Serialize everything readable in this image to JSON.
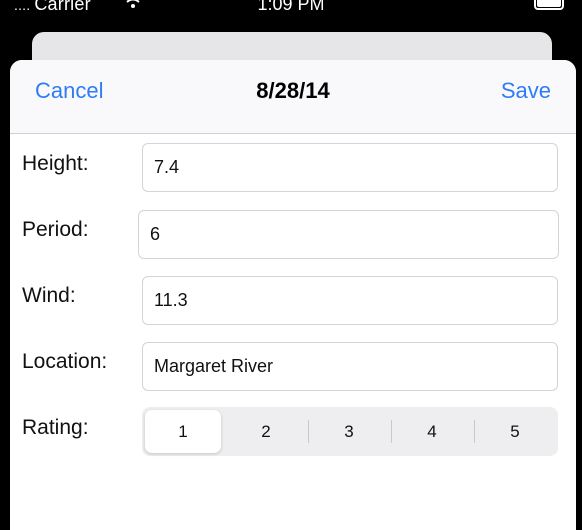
{
  "status_bar": {
    "carrier": "Carrier",
    "carrier_signal": "....",
    "time": "1:09 PM",
    "icons": [
      "wifi-icon",
      "battery-icon"
    ]
  },
  "nav": {
    "cancel_label": "Cancel",
    "title": "8/28/14",
    "save_label": "Save"
  },
  "form": {
    "height": {
      "label": "Height:",
      "value": "7.4"
    },
    "period": {
      "label": "Period:",
      "value": "6"
    },
    "wind": {
      "label": "Wind:",
      "value": "11.3"
    },
    "location": {
      "label": "Location:",
      "value": "Margaret River"
    },
    "rating": {
      "label": "Rating:",
      "options": [
        "1",
        "2",
        "3",
        "4",
        "5"
      ],
      "selected": "1"
    }
  },
  "colors": {
    "accent": "#2f7cf6",
    "nav_background": "#f9f9fb",
    "segment_background": "#eeeef0"
  }
}
